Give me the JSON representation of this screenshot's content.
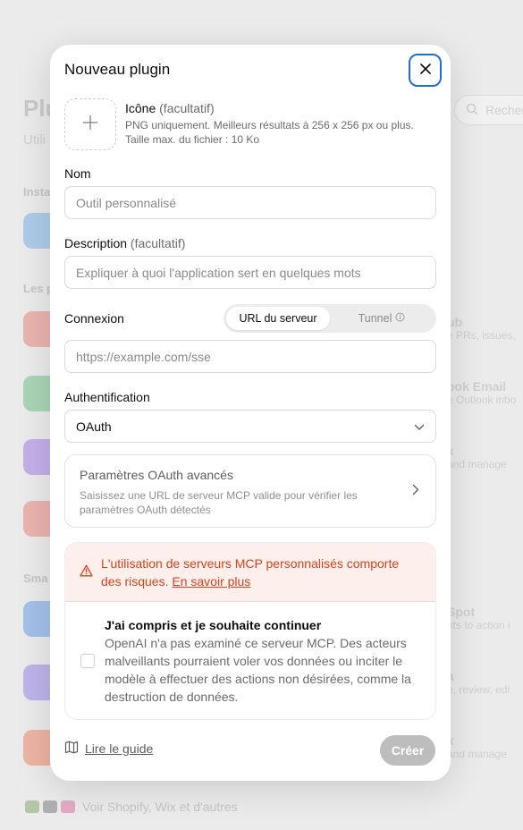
{
  "background": {
    "title": "Plu",
    "subtitle": "Utili",
    "search_placeholder": "Recher",
    "section_installed": "Insta",
    "section_les": "Les p",
    "section_sma": "Sma",
    "right_items": [
      {
        "title": "ub",
        "subtitle": "e PRs, issues,"
      },
      {
        "title": "ook Email",
        "subtitle": "e Outlook inbo"
      },
      {
        "title": "x",
        "subtitle": "and manage"
      },
      {
        "title": "Spot",
        "subtitle": "nts to action i"
      },
      {
        "title": "a",
        "subtitle": "e, review, edi"
      },
      {
        "title": "x",
        "subtitle": "and manage"
      }
    ],
    "bottom_link": "Voir Shopify, Wix et d'autres"
  },
  "modal": {
    "title": "Nouveau plugin",
    "icon": {
      "label": "Icône",
      "optional": "(facultatif)",
      "hint_line1": "PNG uniquement. Meilleurs résultats à 256 x 256 px ou plus.",
      "hint_line2": "Taille max. du fichier : 10 Ko"
    },
    "name": {
      "label": "Nom",
      "placeholder": "Outil personnalisé"
    },
    "description": {
      "label": "Description",
      "optional": "(facultatif)",
      "placeholder": "Expliquer à quoi l'application sert en quelques mots"
    },
    "connection": {
      "label": "Connexion",
      "options": [
        "URL du serveur",
        "Tunnel"
      ],
      "selected": "URL du serveur",
      "url_placeholder": "https://example.com/sse"
    },
    "auth": {
      "label": "Authentification",
      "value": "OAuth"
    },
    "advanced": {
      "title": "Paramètres OAuth avancés",
      "description": "Saisissez une URL de serveur MCP valide pour vérifier les paramètres OAuth détectés"
    },
    "risk": {
      "warning": "L'utilisation de serveurs MCP personnalisés comporte des risques.",
      "learn_more": "En savoir plus",
      "ack_title": "J'ai compris et je souhaite continuer",
      "ack_description": "OpenAI n'a pas examiné ce serveur MCP. Des acteurs malveillants pourraient voler vos données ou inciter le modèle à effectuer des actions non désirées, comme la destruction de données."
    },
    "footer": {
      "guide_label": "Lire le guide",
      "create_label": "Créer"
    }
  },
  "colors": {
    "accent": "#1d6fd6",
    "danger": "#d9421e",
    "danger_bg": "#fdf0ec",
    "disabled": "#bdbdbd"
  }
}
